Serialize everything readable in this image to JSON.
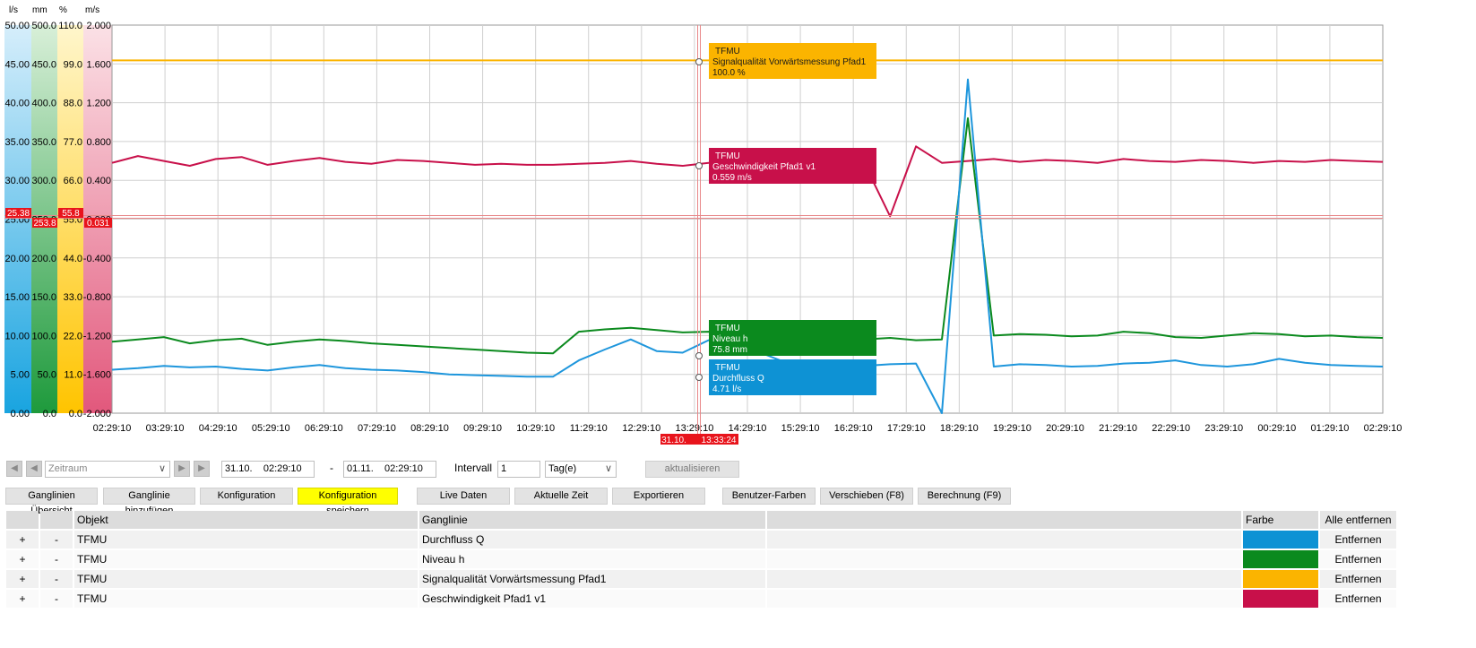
{
  "chart": {
    "unit_headers": [
      "l/s",
      "mm",
      "%",
      "m/s"
    ],
    "axis_lps": [
      "50.00",
      "45.00",
      "40.00",
      "35.00",
      "30.00",
      "25.00",
      "20.00",
      "15.00",
      "10.00",
      "5.00",
      "0.00"
    ],
    "axis_mm": [
      "500.0",
      "450.0",
      "400.0",
      "350.0",
      "300.0",
      "250.0",
      "200.0",
      "150.0",
      "100.0",
      "50.0",
      "0.0"
    ],
    "axis_pct": [
      "110.0",
      "99.0",
      "88.0",
      "77.0",
      "66.0",
      "55.0",
      "44.0",
      "33.0",
      "22.0",
      "11.0",
      "0.0"
    ],
    "axis_ms": [
      "2.000",
      "1.600",
      "1.200",
      "0.800",
      "0.400",
      "0.000",
      "-0.400",
      "-0.800",
      "-1.200",
      "-1.600",
      "-2.000"
    ],
    "cursor_readouts": {
      "lps": "25.38",
      "mm": "253.8",
      "pct": "55.8",
      "ms": "0.031"
    },
    "x_ticks": [
      "02:29:10",
      "03:29:10",
      "04:29:10",
      "05:29:10",
      "06:29:10",
      "07:29:10",
      "08:29:10",
      "09:29:10",
      "10:29:10",
      "11:29:10",
      "12:29:10",
      "13:29:10",
      "14:29:10",
      "15:29:10",
      "16:29:10",
      "17:29:10",
      "18:29:10",
      "19:29:10",
      "20:29:10",
      "21:29:10",
      "22:29:10",
      "23:29:10",
      "00:29:10",
      "01:29:10",
      "02:29:10"
    ],
    "cursor_time": {
      "date": "31.10.",
      "time": "13:33:24"
    },
    "tooltips": [
      {
        "title": "TFMU",
        "name": "Signalqualität Vorwärtsmessung Pfad1",
        "value": "100.0 %",
        "color": "#FBB400"
      },
      {
        "title": "TFMU",
        "name": "Geschwindigkeit Pfad1 v1",
        "value": "0.559 m/s",
        "color": "#C8104A"
      },
      {
        "title": "TFMU",
        "name": "Niveau h",
        "value": "75.8 mm",
        "color": "#0B8A1E"
      },
      {
        "title": "TFMU",
        "name": "Durchfluss Q",
        "value": "4.71 l/s",
        "color": "#0E92D4"
      }
    ]
  },
  "chart_data": {
    "type": "line",
    "x_start": "31.10. 02:29:10",
    "x_end": "01.11. 02:29:10",
    "series": [
      {
        "name": "Durchfluss Q",
        "unit": "l/s",
        "color": "#1E96DC",
        "ylim": [
          0,
          50
        ],
        "values": [
          5.6,
          5.8,
          6.1,
          5.9,
          6.0,
          5.7,
          5.5,
          5.9,
          6.2,
          5.8,
          5.6,
          5.5,
          5.3,
          5.0,
          4.9,
          4.8,
          4.7,
          4.7,
          6.8,
          8.2,
          9.5,
          8.0,
          7.8,
          9.4,
          8.5,
          7.8,
          6.5,
          6.2,
          6.0,
          6.1,
          6.3,
          6.4,
          0,
          43,
          6.0,
          6.3,
          6.2,
          6.0,
          6.1,
          6.4,
          6.5,
          6.8,
          6.2,
          6.0,
          6.3,
          7.0,
          6.5,
          6.2,
          6.1,
          6.0
        ]
      },
      {
        "name": "Niveau h",
        "unit": "mm",
        "color": "#0B8A1E",
        "ylim": [
          0,
          500
        ],
        "values": [
          92,
          95,
          98,
          90,
          94,
          96,
          88,
          92,
          95,
          93,
          90,
          88,
          86,
          84,
          82,
          80,
          78,
          77,
          105,
          108,
          110,
          107,
          104,
          105,
          100,
          98,
          95,
          97,
          96,
          95,
          97,
          94,
          95,
          380,
          100,
          102,
          101,
          99,
          100,
          105,
          103,
          98,
          97,
          100,
          103,
          102,
          99,
          100,
          98,
          97
        ]
      },
      {
        "name": "Signalqualität Vorwärtsmessung Pfad1",
        "unit": "%",
        "color": "#FBB400",
        "ylim": [
          0,
          110
        ],
        "values": [
          100,
          100,
          100,
          100,
          100,
          100,
          100,
          100,
          100,
          100,
          100,
          100,
          100,
          100,
          100,
          100,
          100,
          100,
          100,
          100,
          100,
          100,
          100,
          100,
          100,
          100,
          100,
          100,
          100,
          100,
          100,
          100,
          100,
          100,
          100,
          100,
          100,
          100,
          100,
          100,
          100,
          100,
          100,
          100,
          100,
          100,
          100,
          100,
          100,
          100
        ]
      },
      {
        "name": "Geschwindigkeit Pfad1 v1",
        "unit": "m/s",
        "color": "#C8104A",
        "ylim": [
          -2,
          2
        ],
        "values": [
          0.58,
          0.65,
          0.6,
          0.55,
          0.62,
          0.64,
          0.56,
          0.6,
          0.63,
          0.59,
          0.57,
          0.61,
          0.6,
          0.58,
          0.56,
          0.57,
          0.56,
          0.56,
          0.57,
          0.58,
          0.6,
          0.57,
          0.55,
          0.58,
          0.62,
          0.6,
          0.57,
          0.59,
          0.63,
          0.58,
          0.03,
          0.75,
          0.58,
          0.6,
          0.62,
          0.59,
          0.61,
          0.6,
          0.58,
          0.62,
          0.6,
          0.59,
          0.61,
          0.6,
          0.58,
          0.6,
          0.59,
          0.61,
          0.6,
          0.59
        ]
      }
    ]
  },
  "toolbar": {
    "period_placeholder": "Zeitraum",
    "from_date": "31.10.",
    "from_time": "02:29:10",
    "dash": "-",
    "to_date": "01.11.",
    "to_time": "02:29:10",
    "interval_label": "Intervall",
    "interval_value": "1",
    "interval_unit": "Tag(e)",
    "refresh": "aktualisieren"
  },
  "buttons": {
    "overview": "Ganglinien Übersicht",
    "add": "Ganglinie hinzufügen",
    "config": "Konfiguration",
    "save_config": "Konfiguration speichern",
    "live": "Live Daten",
    "current_time": "Aktuelle Zeit",
    "export": "Exportieren",
    "user_colors": "Benutzer-Farben",
    "shift": "Verschieben (F8)",
    "calc": "Berechnung (F9)"
  },
  "table": {
    "headers": {
      "object": "Objekt",
      "series": "Ganglinie",
      "color": "Farbe",
      "remove_all": "Alle entfernen"
    },
    "rows": [
      {
        "plus": "+",
        "minus": "-",
        "object": "TFMU",
        "series": "Durchfluss Q",
        "color": "#0E92D4",
        "remove": "Entfernen"
      },
      {
        "plus": "+",
        "minus": "-",
        "object": "TFMU",
        "series": "Niveau h",
        "color": "#0B8A1E",
        "remove": "Entfernen"
      },
      {
        "plus": "+",
        "minus": "-",
        "object": "TFMU",
        "series": "Signalqualität Vorwärtsmessung Pfad1",
        "color": "#FBB400",
        "remove": "Entfernen"
      },
      {
        "plus": "+",
        "minus": "-",
        "object": "TFMU",
        "series": "Geschwindigkeit Pfad1 v1",
        "color": "#C8104A",
        "remove": "Entfernen"
      }
    ]
  }
}
